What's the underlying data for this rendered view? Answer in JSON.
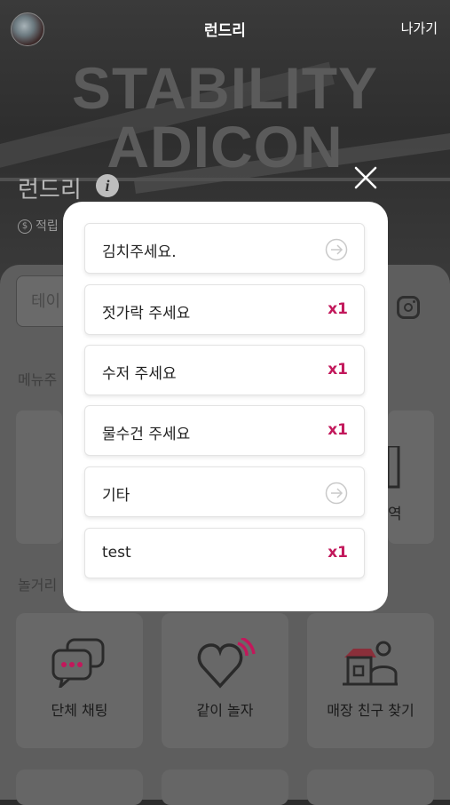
{
  "header": {
    "title": "런드리",
    "exit_label": "나가기",
    "hero_line1": "STABILITY",
    "hero_line2": "ADICON"
  },
  "store": {
    "name": "런드리",
    "points_label": "적립"
  },
  "table_input": {
    "text": "테이"
  },
  "sections": {
    "menu_label": "메뉴주",
    "play_label": "놀거리",
    "menu_right_label": "역"
  },
  "play_cards": [
    {
      "label": "단체 채팅",
      "icon": "chat-bubbles-icon"
    },
    {
      "label": "같이 놀자",
      "icon": "heart-signal-icon"
    },
    {
      "label": "매장 친구 찾기",
      "icon": "store-person-icon"
    }
  ],
  "modal": {
    "options": [
      {
        "label": "김치주세요.",
        "type": "arrow",
        "qty": ""
      },
      {
        "label": "젓가락 주세요",
        "type": "qty",
        "qty": "x1"
      },
      {
        "label": "수저 주세요",
        "type": "qty",
        "qty": "x1"
      },
      {
        "label": "물수건 주세요",
        "type": "qty",
        "qty": "x1"
      },
      {
        "label": "기타",
        "type": "arrow",
        "qty": ""
      },
      {
        "label": "test",
        "type": "qty",
        "qty": "x1"
      }
    ]
  },
  "colors": {
    "accent": "#c2185b",
    "overlay_bg": "#5e5e5e",
    "modal_bg": "#ffffff"
  }
}
